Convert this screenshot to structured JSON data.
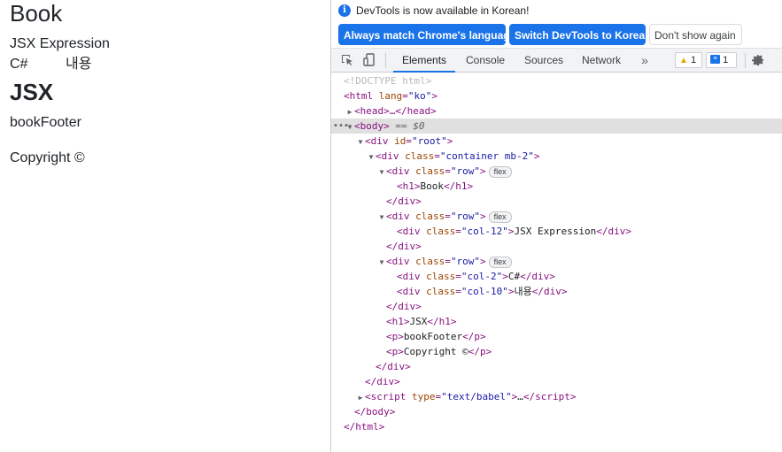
{
  "page": {
    "heading_book": "Book",
    "jsx_expression": "JSX Expression",
    "csharp": "C#",
    "content_korean": "내용",
    "heading_jsx": "JSX",
    "book_footer": "bookFooter",
    "copyright": "Copyright ©"
  },
  "devtools": {
    "infobar": {
      "message": "DevTools is now available in Korean!",
      "btn_match": "Always match Chrome's language",
      "btn_switch": "Switch DevTools to Korean",
      "btn_dont": "Don't show again"
    },
    "tabs": [
      "Elements",
      "Console",
      "Sources",
      "Network"
    ],
    "more_glyph": "»",
    "warnings_count": "1",
    "messages_count": "1",
    "icons": [
      "inspect-element-icon",
      "device-toolbar-icon",
      "more-tabs-icon",
      "warning-icon",
      "message-icon",
      "gear-icon"
    ],
    "accent_color": "#1a73e8",
    "tree": {
      "doctype": "<!DOCTYPE html>",
      "html_open": "<html",
      "html_lang_attr": "lang",
      "html_lang_val": "\"ko\"",
      "head_collapsed": "<head>…</head>",
      "body_open": "<body>",
      "body_eq": " == $0",
      "div_root_attr": "id",
      "div_root_val": "\"root\"",
      "container_val": "\"container mb-2\"",
      "row_val": "\"row\"",
      "col12_val": "\"col-12\"",
      "col2_val": "\"col-2\"",
      "col10_val": "\"col-10\"",
      "class_attr": "class",
      "flex_badge": "flex",
      "h1_book_text": "Book",
      "jsx_expr_text": "JSX Expression",
      "csharp_text": "C#",
      "korean_text": "내용",
      "h1_jsx_text": "JSX",
      "p_footer_text": "bookFooter",
      "p_copy_text": "Copyright ©",
      "script_type_attr": "type",
      "script_type_val": "\"text/babel\"",
      "ellipsis": "…"
    }
  }
}
